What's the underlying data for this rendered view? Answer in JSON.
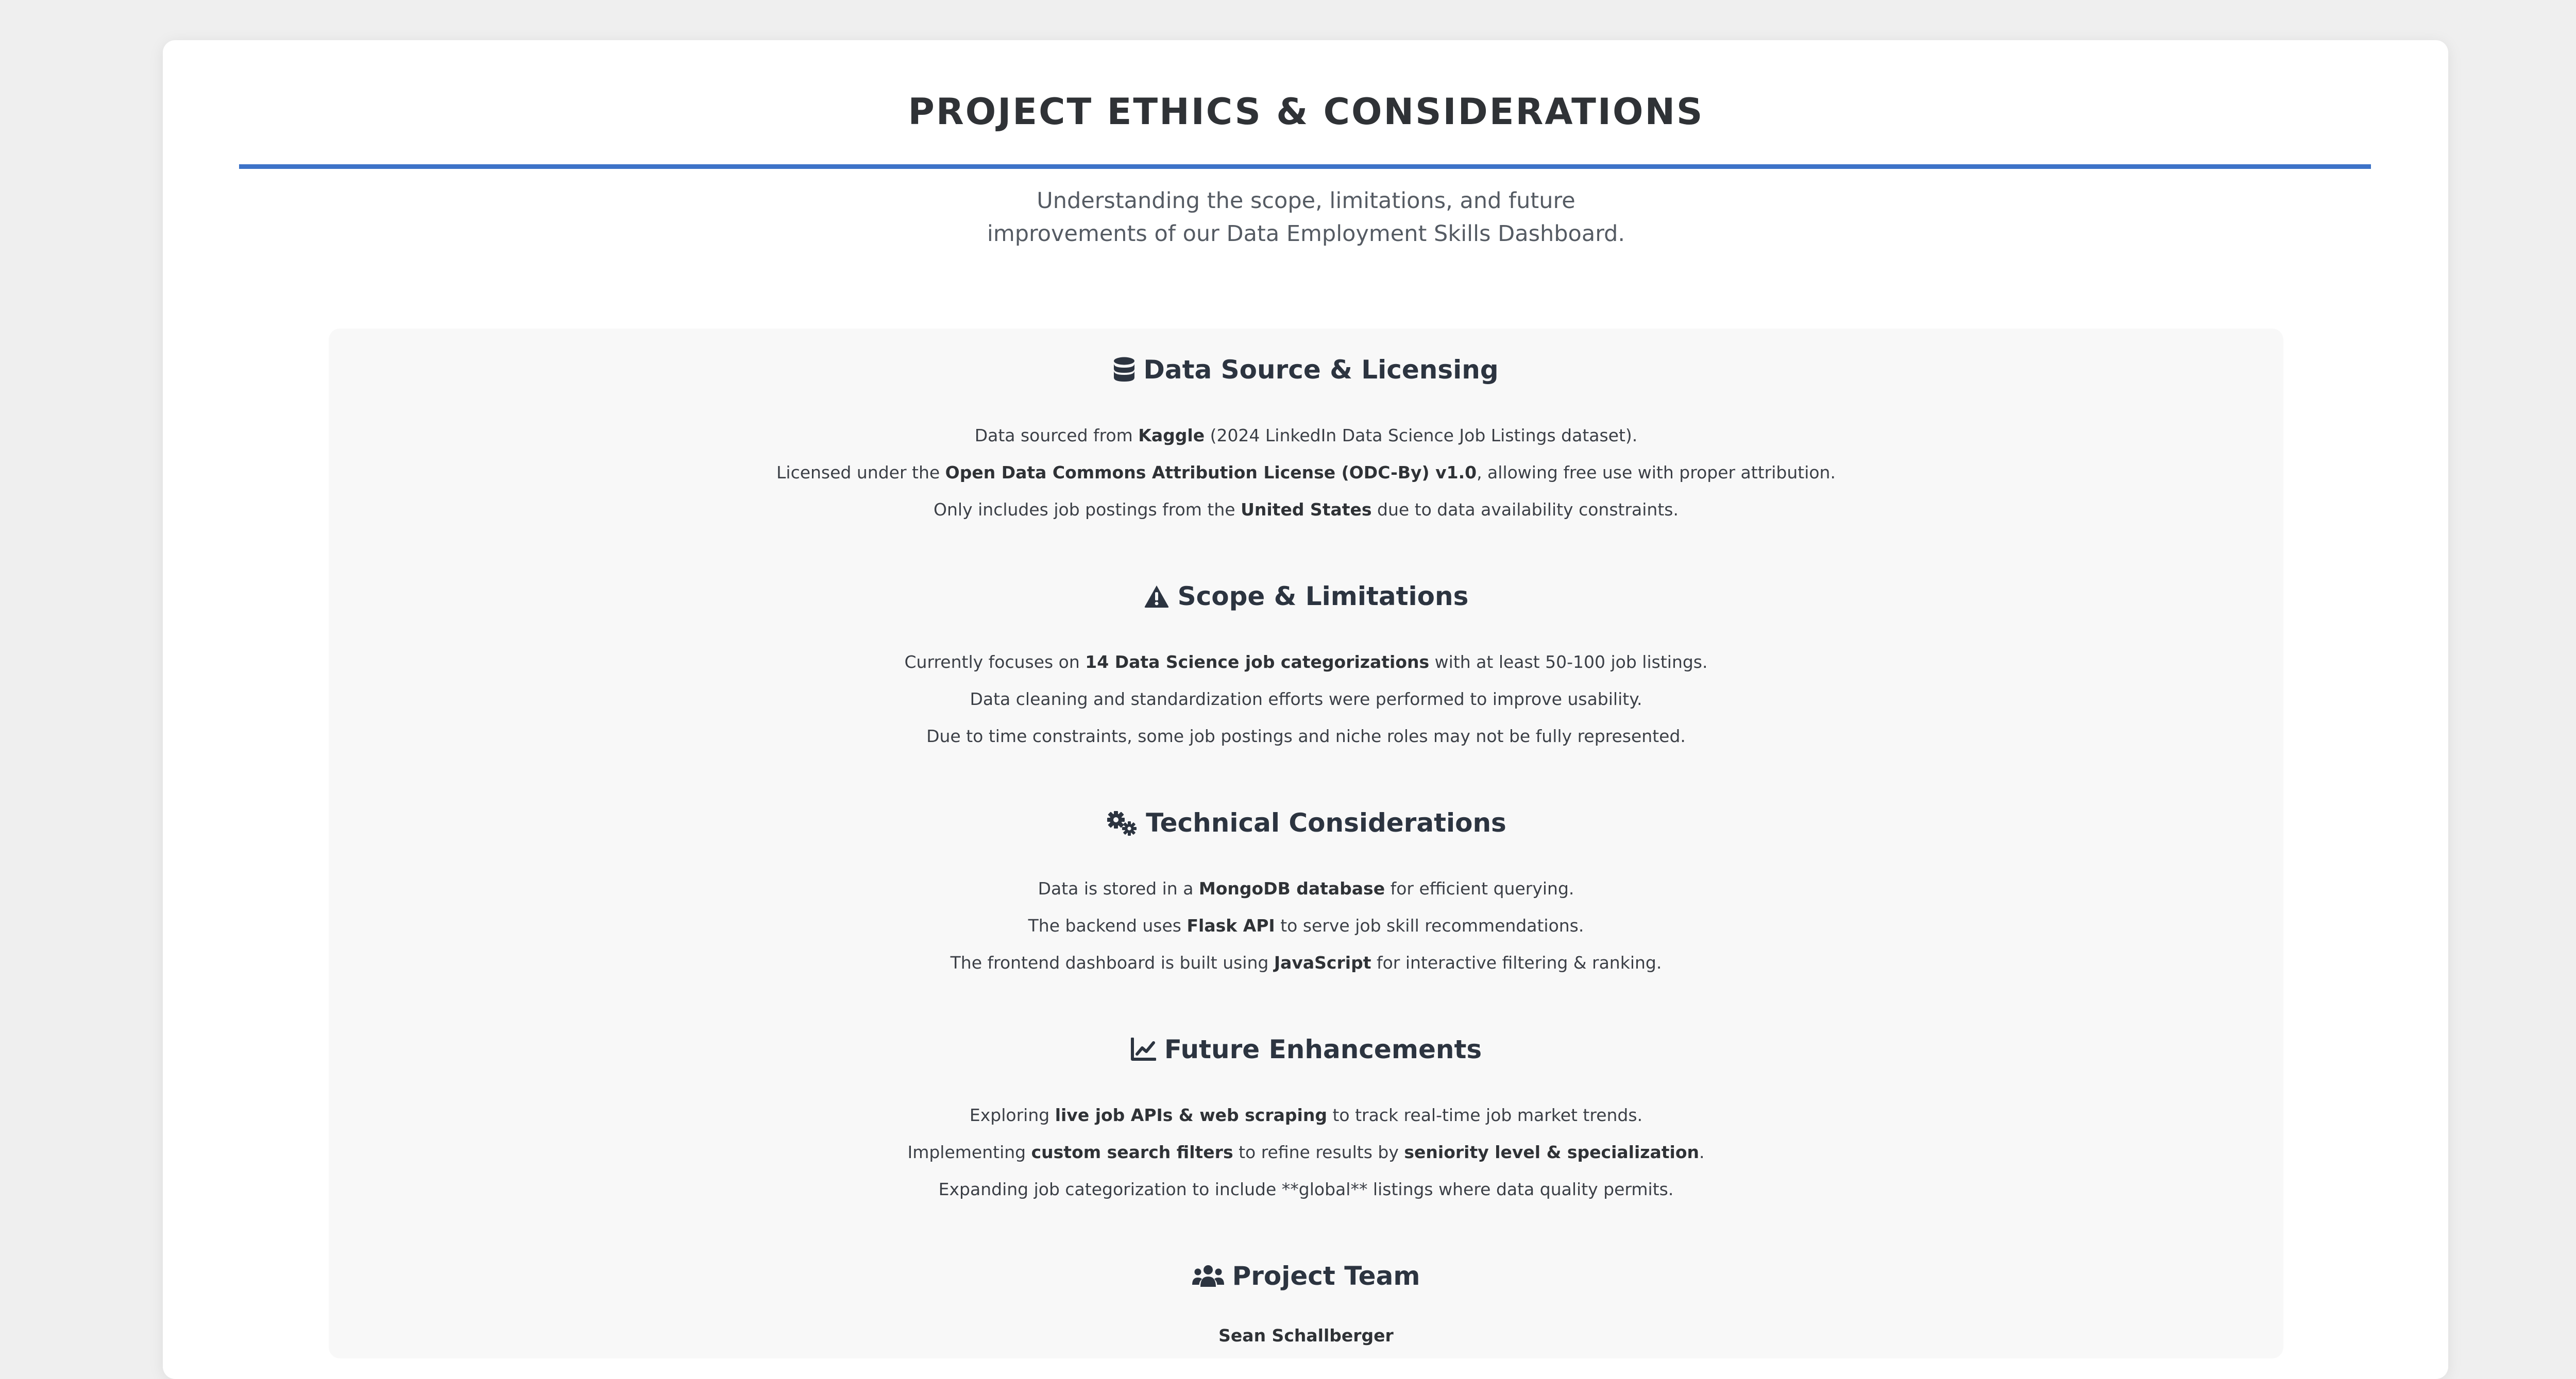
{
  "header": {
    "title": "PROJECT ETHICS & CONSIDERATIONS",
    "subtitle_line1": "Understanding the scope, limitations, and future",
    "subtitle_line2": "improvements of our Data Employment Skills Dashboard."
  },
  "sections": [
    {
      "icon": "database-icon",
      "title": "Data Source & Licensing",
      "lines": [
        [
          {
            "text": "Data sourced from "
          },
          {
            "text": "Kaggle",
            "bold": true
          },
          {
            "text": " (2024 LinkedIn Data Science Job Listings dataset)."
          }
        ],
        [
          {
            "text": "Licensed under the "
          },
          {
            "text": "Open Data Commons Attribution License (ODC-By) v1.0",
            "bold": true
          },
          {
            "text": ", allowing free use with proper attribution."
          }
        ],
        [
          {
            "text": "Only includes job postings from the "
          },
          {
            "text": "United States",
            "bold": true
          },
          {
            "text": " due to data availability constraints."
          }
        ]
      ]
    },
    {
      "icon": "warning-icon",
      "title": "Scope & Limitations",
      "lines": [
        [
          {
            "text": "Currently focuses on "
          },
          {
            "text": "14 Data Science job categorizations",
            "bold": true
          },
          {
            "text": " with at least 50-100 job listings."
          }
        ],
        [
          {
            "text": "Data cleaning and standardization efforts were performed to improve usability."
          }
        ],
        [
          {
            "text": "Due to time constraints, some job postings and niche roles may not be fully represented."
          }
        ]
      ]
    },
    {
      "icon": "gears-icon",
      "title": "Technical Considerations",
      "lines": [
        [
          {
            "text": "Data is stored in a "
          },
          {
            "text": "MongoDB database",
            "bold": true
          },
          {
            "text": " for efficient querying."
          }
        ],
        [
          {
            "text": "The backend uses "
          },
          {
            "text": "Flask API",
            "bold": true
          },
          {
            "text": " to serve job skill recommendations."
          }
        ],
        [
          {
            "text": "The frontend dashboard is built using "
          },
          {
            "text": "JavaScript",
            "bold": true
          },
          {
            "text": " for interactive filtering & ranking."
          }
        ]
      ]
    },
    {
      "icon": "chart-line-icon",
      "title": "Future Enhancements",
      "lines": [
        [
          {
            "text": "Exploring "
          },
          {
            "text": "live job APIs & web scraping",
            "bold": true
          },
          {
            "text": " to track real-time job market trends."
          }
        ],
        [
          {
            "text": "Implementing "
          },
          {
            "text": "custom search filters",
            "bold": true
          },
          {
            "text": " to refine results by "
          },
          {
            "text": "seniority level & specialization",
            "bold": true
          },
          {
            "text": "."
          }
        ],
        [
          {
            "text": "Expanding job categorization to include **global** listings where data quality permits."
          }
        ]
      ]
    },
    {
      "icon": "users-icon",
      "title": "Project Team",
      "lines": [
        [
          {
            "text": "Sean Schallberger",
            "bold": true
          }
        ]
      ]
    }
  ]
}
